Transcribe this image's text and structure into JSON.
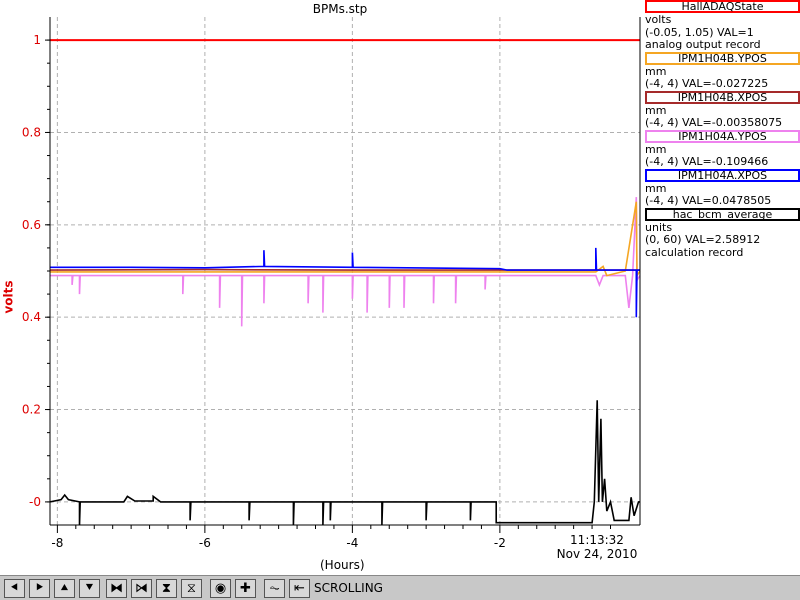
{
  "title": "BPMs.stp",
  "toolbar": {
    "buttons": [
      {
        "name": "pan-left-button",
        "glyph": "⯇"
      },
      {
        "name": "pan-right-button",
        "glyph": "⯈"
      },
      {
        "name": "pan-up-button",
        "glyph": "⯅"
      },
      {
        "name": "pan-down-button",
        "glyph": "⯆"
      },
      {
        "name": "zoom-in-x-button",
        "glyph": "⧓"
      },
      {
        "name": "zoom-out-x-button",
        "glyph": "⧒"
      },
      {
        "name": "zoom-in-y-button",
        "glyph": "⧗"
      },
      {
        "name": "zoom-out-y-button",
        "glyph": "⧖"
      },
      {
        "name": "auto-scale-button",
        "glyph": "◉"
      },
      {
        "name": "add-button",
        "glyph": "✚"
      },
      {
        "name": "scroll-button",
        "glyph": "⏦"
      },
      {
        "name": "back-button",
        "glyph": "⇤"
      }
    ],
    "mode": "SCROLLING"
  },
  "legend": [
    {
      "name": "HallADAQState",
      "color": "#ff0000",
      "lines": [
        "volts",
        "(-0.05, 1.05) VAL=1",
        "analog output record"
      ]
    },
    {
      "name": "IPM1H04B.YPOS",
      "color": "#f5a623",
      "lines": [
        "mm",
        "(-4, 4) VAL=-0.027225"
      ]
    },
    {
      "name": "IPM1H04B.XPOS",
      "color": "#a52a2a",
      "lines": [
        "mm",
        "(-4, 4) VAL=-0.00358075"
      ]
    },
    {
      "name": "IPM1H04A.YPOS",
      "color": "#ee82ee",
      "lines": [
        "mm",
        "(-4, 4) VAL=-0.109466"
      ]
    },
    {
      "name": "IPM1H04A.XPOS",
      "color": "#0000ff",
      "lines": [
        "mm",
        "(-4, 4) VAL=0.0478505"
      ]
    },
    {
      "name": "hac_bcm_average",
      "color": "#000000",
      "lines": [
        "units",
        "(0, 60) VAL=2.58912",
        "calculation record"
      ]
    }
  ],
  "chart_data": {
    "type": "line",
    "title": "BPMs.stp",
    "xlabel": "(Hours)",
    "ylabel": "volts",
    "xlim": [
      -8.1,
      -0.1
    ],
    "ylim": [
      -0.05,
      1.05
    ],
    "x_ticks": [
      -8,
      -6,
      -4,
      -2
    ],
    "x_tick_labels": [
      "-8",
      "-6",
      "-4",
      "-2"
    ],
    "y_ticks": [
      0,
      0.2,
      0.4,
      0.6,
      0.8,
      1
    ],
    "y_tick_labels": [
      "-0",
      "0.2",
      "0.4",
      "0.6",
      "0.8",
      "1"
    ],
    "time_label": "11:13:32",
    "date_label": "Nov 24, 2010",
    "grid": true,
    "series": [
      {
        "name": "HallADAQState",
        "color": "#ff0000",
        "points": [
          [
            -8.1,
            1.0
          ],
          [
            -0.1,
            1.0
          ]
        ]
      },
      {
        "name": "IPM1H04A.YPOS",
        "color": "#ee82ee",
        "points": [
          [
            -8.1,
            0.49
          ],
          [
            -7.8,
            0.49
          ],
          [
            -7.8,
            0.47
          ],
          [
            -7.79,
            0.49
          ],
          [
            -7.7,
            0.49
          ],
          [
            -7.7,
            0.45
          ],
          [
            -7.69,
            0.49
          ],
          [
            -6.3,
            0.49
          ],
          [
            -6.3,
            0.45
          ],
          [
            -6.29,
            0.49
          ],
          [
            -6.0,
            0.49
          ],
          [
            -5.8,
            0.49
          ],
          [
            -5.8,
            0.42
          ],
          [
            -5.79,
            0.49
          ],
          [
            -5.5,
            0.49
          ],
          [
            -5.5,
            0.38
          ],
          [
            -5.49,
            0.49
          ],
          [
            -5.2,
            0.49
          ],
          [
            -5.2,
            0.43
          ],
          [
            -5.19,
            0.49
          ],
          [
            -4.6,
            0.49
          ],
          [
            -4.6,
            0.43
          ],
          [
            -4.59,
            0.49
          ],
          [
            -4.4,
            0.49
          ],
          [
            -4.4,
            0.41
          ],
          [
            -4.39,
            0.49
          ],
          [
            -4.0,
            0.49
          ],
          [
            -4.0,
            0.44
          ],
          [
            -3.99,
            0.49
          ],
          [
            -3.8,
            0.49
          ],
          [
            -3.8,
            0.41
          ],
          [
            -3.79,
            0.49
          ],
          [
            -3.5,
            0.49
          ],
          [
            -3.5,
            0.42
          ],
          [
            -3.49,
            0.49
          ],
          [
            -3.3,
            0.49
          ],
          [
            -3.3,
            0.42
          ],
          [
            -3.29,
            0.49
          ],
          [
            -2.9,
            0.49
          ],
          [
            -2.9,
            0.43
          ],
          [
            -2.89,
            0.49
          ],
          [
            -2.6,
            0.49
          ],
          [
            -2.6,
            0.43
          ],
          [
            -2.59,
            0.49
          ],
          [
            -2.2,
            0.49
          ],
          [
            -2.2,
            0.46
          ],
          [
            -2.19,
            0.49
          ],
          [
            -2.0,
            0.49
          ],
          [
            -0.7,
            0.49
          ],
          [
            -0.65,
            0.47
          ],
          [
            -0.6,
            0.49
          ],
          [
            -0.3,
            0.49
          ],
          [
            -0.25,
            0.42
          ],
          [
            -0.2,
            0.49
          ],
          [
            -0.15,
            0.66
          ],
          [
            -0.14,
            0.48
          ],
          [
            -0.1,
            0.49
          ]
        ]
      },
      {
        "name": "IPM1H04B.YPOS",
        "color": "#f5a623",
        "points": [
          [
            -8.1,
            0.498
          ],
          [
            -6.0,
            0.498
          ],
          [
            -4.0,
            0.498
          ],
          [
            -2.0,
            0.498
          ],
          [
            -0.7,
            0.498
          ],
          [
            -0.6,
            0.51
          ],
          [
            -0.55,
            0.49
          ],
          [
            -0.3,
            0.5
          ],
          [
            -0.15,
            0.65
          ],
          [
            -0.14,
            0.49
          ],
          [
            -0.1,
            0.5
          ]
        ]
      },
      {
        "name": "IPM1H04B.XPOS",
        "color": "#a52a2a",
        "points": [
          [
            -8.1,
            0.502
          ],
          [
            -6.0,
            0.503
          ],
          [
            -4.0,
            0.502
          ],
          [
            -2.0,
            0.502
          ],
          [
            -0.1,
            0.502
          ]
        ]
      },
      {
        "name": "IPM1H04A.XPOS",
        "color": "#0000ff",
        "points": [
          [
            -8.1,
            0.508
          ],
          [
            -7.0,
            0.508
          ],
          [
            -6.0,
            0.507
          ],
          [
            -5.2,
            0.51
          ],
          [
            -5.2,
            0.545
          ],
          [
            -5.19,
            0.51
          ],
          [
            -4.0,
            0.508
          ],
          [
            -4.0,
            0.54
          ],
          [
            -3.99,
            0.508
          ],
          [
            -2.0,
            0.505
          ],
          [
            -1.9,
            0.502
          ],
          [
            -0.7,
            0.502
          ],
          [
            -0.7,
            0.55
          ],
          [
            -0.69,
            0.502
          ],
          [
            -0.15,
            0.502
          ],
          [
            -0.15,
            0.4
          ],
          [
            -0.14,
            0.502
          ],
          [
            -0.1,
            0.502
          ]
        ]
      },
      {
        "name": "hac_bcm_average",
        "color": "#000000",
        "points": [
          [
            -8.1,
            0.0
          ],
          [
            -7.95,
            0.005
          ],
          [
            -7.9,
            0.015
          ],
          [
            -7.85,
            0.005
          ],
          [
            -7.7,
            0.0
          ],
          [
            -7.7,
            -0.05
          ],
          [
            -7.69,
            0.0
          ],
          [
            -7.1,
            0.0
          ],
          [
            -7.05,
            0.012
          ],
          [
            -6.95,
            0.002
          ],
          [
            -6.7,
            0.002
          ],
          [
            -6.7,
            0.012
          ],
          [
            -6.6,
            0.0
          ],
          [
            -6.2,
            0.0
          ],
          [
            -6.2,
            -0.04
          ],
          [
            -6.19,
            0.0
          ],
          [
            -5.4,
            0.0
          ],
          [
            -5.4,
            -0.04
          ],
          [
            -5.39,
            0.0
          ],
          [
            -4.8,
            0.0
          ],
          [
            -4.8,
            -0.05
          ],
          [
            -4.79,
            0.0
          ],
          [
            -4.4,
            0.0
          ],
          [
            -4.4,
            -0.05
          ],
          [
            -4.39,
            0.0
          ],
          [
            -4.3,
            0.0
          ],
          [
            -4.3,
            -0.04
          ],
          [
            -4.29,
            0.0
          ],
          [
            -3.6,
            0.0
          ],
          [
            -3.6,
            -0.05
          ],
          [
            -3.59,
            0.0
          ],
          [
            -3.0,
            0.0
          ],
          [
            -3.0,
            -0.04
          ],
          [
            -2.99,
            0.0
          ],
          [
            -2.4,
            0.0
          ],
          [
            -2.4,
            -0.04
          ],
          [
            -2.39,
            0.0
          ],
          [
            -2.05,
            0.0
          ],
          [
            -2.05,
            -0.045
          ],
          [
            -0.75,
            -0.045
          ],
          [
            -0.72,
            0.0
          ],
          [
            -0.68,
            0.22
          ],
          [
            -0.66,
            0.0
          ],
          [
            -0.63,
            0.18
          ],
          [
            -0.61,
            0.0
          ],
          [
            -0.58,
            0.05
          ],
          [
            -0.55,
            -0.02
          ],
          [
            -0.5,
            0.0
          ],
          [
            -0.45,
            -0.04
          ],
          [
            -0.25,
            -0.04
          ],
          [
            -0.22,
            0.01
          ],
          [
            -0.18,
            -0.03
          ],
          [
            -0.12,
            0.0
          ],
          [
            -0.1,
            0.0
          ]
        ]
      }
    ]
  }
}
